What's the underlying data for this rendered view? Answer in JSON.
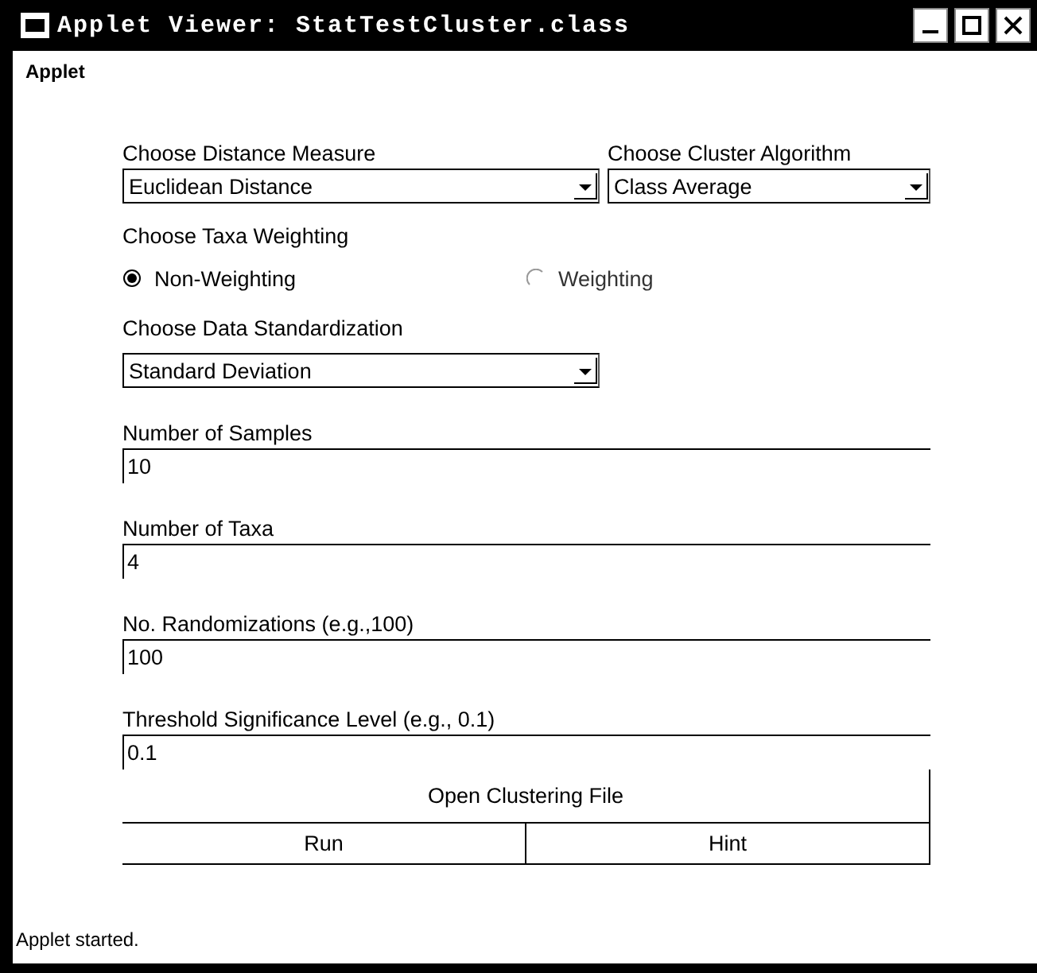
{
  "window": {
    "title": "Applet Viewer: StatTestCluster.class"
  },
  "menu": [
    "Applet"
  ],
  "distance_measure": {
    "label": "Choose Distance Measure",
    "value": "Euclidean Distance"
  },
  "cluster_algorithm": {
    "label": "Choose Cluster Algorithm",
    "value": "Class Average"
  },
  "taxa_weighting": {
    "label": "Choose Taxa Weighting",
    "options": [
      {
        "label": "Non-Weighting",
        "selected": true
      },
      {
        "label": "Weighting",
        "selected": false
      }
    ]
  },
  "data_standardization": {
    "label": "Choose Data Standardization",
    "value": "Standard Deviation"
  },
  "fields": [
    {
      "label": "Number of Samples",
      "value": "10"
    },
    {
      "label": "Number of Taxa",
      "value": "4"
    },
    {
      "label": "No. Randomizations (e.g.,100)",
      "value": "100"
    },
    {
      "label": "Threshold Significance Level (e.g., 0.1)",
      "value": "0.1"
    }
  ],
  "buttons": {
    "open": "Open Clustering File",
    "run": "Run",
    "hint": "Hint"
  },
  "status_bar": "Applet started."
}
